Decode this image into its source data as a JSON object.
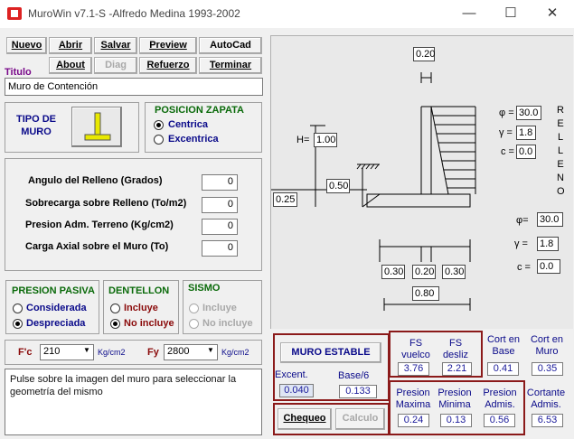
{
  "window": {
    "title": "MuroWin v7.1-S -Alfredo Medina 1993-2002",
    "minimize": "—",
    "maximize": "☐",
    "close": "✕"
  },
  "toolbar": {
    "nuevo": "Nuevo",
    "abrir": "Abrir",
    "salvar": "Salvar",
    "preview": "Preview",
    "autocad": "AutoCad",
    "about": "About",
    "diag": "Diag",
    "refuerzo": "Refuerzo",
    "terminar": "Terminar"
  },
  "titulo": {
    "label": "Titulo",
    "value": "Muro de Contención"
  },
  "tipo_muro": {
    "label_line1": "TIPO DE",
    "label_line2": "MURO"
  },
  "posicion_zapata": {
    "title": "POSICION ZAPATA",
    "options": [
      "Centrica",
      "Excentrica"
    ],
    "selected": 0
  },
  "parametros": [
    {
      "label": "Angulo del Relleno (Grados)",
      "value": "0"
    },
    {
      "label": "Sobrecarga sobre Relleno (To/m2)",
      "value": "0"
    },
    {
      "label": "Presion Adm. Terreno (Kg/cm2)",
      "value": "0"
    },
    {
      "label": "Carga Axial sobre el Muro (To)",
      "value": "0"
    }
  ],
  "presion_pasiva": {
    "title": "PRESION PASIVA",
    "options": [
      "Considerada",
      "Despreciada"
    ],
    "selected": 1
  },
  "dentellon": {
    "title": "DENTELLON",
    "options": [
      "Incluye",
      "No incluye"
    ],
    "selected": 1
  },
  "sismo": {
    "title": "SISMO",
    "options": [
      "Incluye",
      "No incluye"
    ],
    "enabled": false
  },
  "materiales": {
    "fc_label": "F'c",
    "fc_value": "210",
    "fc_unit": "Kg/cm2",
    "fy_label": "Fy",
    "fy_value": "2800",
    "fy_unit": "Kg/cm2"
  },
  "mensaje": "Pulse sobre la imagen del muro para seleccionar la geometría del mismo",
  "diagram": {
    "top_width": "0.20",
    "height_label": "H=",
    "height": "1.00",
    "relleno": "R E L L E N O",
    "phi_label": "φ =",
    "phi": "30.0",
    "gamma_label": "γ =",
    "gamma": "1.8",
    "c_label": "c =",
    "c": "0.0",
    "footing_thk": "0.25",
    "toe_depth": "0.50",
    "phi2_label": "φ=",
    "phi2": "30.0",
    "gamma2_label": "γ =",
    "gamma2": "1.8",
    "c2_label": "c =",
    "c2": "0.0",
    "dim_left": "0.30",
    "dim_mid": "0.20",
    "dim_right": "0.30",
    "dim_total": "0.80"
  },
  "results": {
    "estable_button": "MURO ESTABLE",
    "excent_label": "Excent.",
    "excent": "0.040",
    "base6_label": "Base/6",
    "base6": "0.133",
    "fs_vuelco_label": "FS vuelco",
    "fs_vuelco": "3.76",
    "fs_desliz_label": "FS desliz",
    "fs_desliz": "2.21",
    "cort_base_label": "Cort en Base",
    "cort_base": "0.41",
    "cort_muro_label": "Cort en Muro",
    "cort_muro": "0.35",
    "pmax_label": "Presion Maxima",
    "pmax": "0.24",
    "pmin_label": "Presion Minima",
    "pmin": "0.13",
    "padm_label": "Presion Admis.",
    "padm": "0.56",
    "cortante_label": "Cortante Admis.",
    "cortante": "6.53",
    "chequeo": "Chequeo",
    "calculo": "Calculo"
  }
}
